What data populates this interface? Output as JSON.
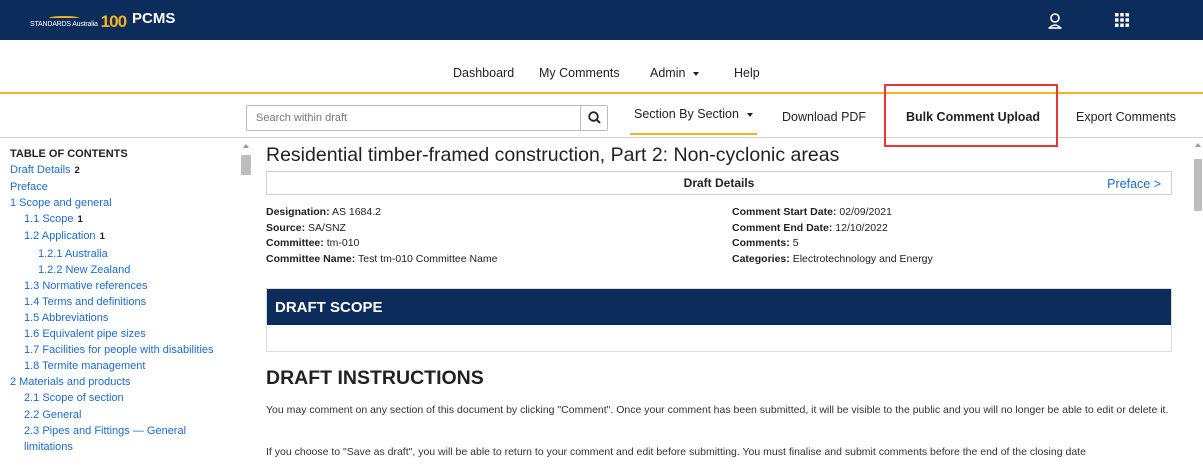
{
  "header": {
    "logo_text_small": "STANDARDS Australia",
    "logo_text_big": "100",
    "app_name": "PCMS"
  },
  "nav": {
    "dashboard": "Dashboard",
    "my_comments": "My Comments",
    "admin": "Admin",
    "help": "Help"
  },
  "toolbar": {
    "search_placeholder": "Search within draft",
    "section_by_section": "Section By Section",
    "download_pdf": "Download PDF",
    "bulk_comment_upload": "Bulk Comment Upload",
    "export_comments": "Export Comments"
  },
  "toc": {
    "title": "TABLE OF CONTENTS",
    "items": [
      {
        "label": "Draft Details",
        "count": "2",
        "level": 1
      },
      {
        "label": "Preface",
        "count": "",
        "level": 1
      },
      {
        "label": "1 Scope and general",
        "count": "",
        "level": 1
      },
      {
        "label": "1.1 Scope",
        "count": "1",
        "level": 2
      },
      {
        "label": "1.2 Application",
        "count": "1",
        "level": 2
      },
      {
        "label": "1.2.1 Australia",
        "count": "",
        "level": 3
      },
      {
        "label": "1.2.2 New Zealand",
        "count": "",
        "level": 3
      },
      {
        "label": "1.3 Normative references",
        "count": "",
        "level": 2
      },
      {
        "label": "1.4 Terms and definitions",
        "count": "",
        "level": 2
      },
      {
        "label": "1.5 Abbreviations",
        "count": "",
        "level": 2
      },
      {
        "label": "1.6 Equivalent pipe sizes",
        "count": "",
        "level": 2
      },
      {
        "label": "1.7 Facilities for people with disabilities",
        "count": "",
        "level": 2
      },
      {
        "label": "1.8 Termite management",
        "count": "",
        "level": 2
      },
      {
        "label": "2 Materials and products",
        "count": "",
        "level": 1
      },
      {
        "label": "2.1 Scope of section",
        "count": "",
        "level": 2
      },
      {
        "label": "2.2 General",
        "count": "",
        "level": 2
      },
      {
        "label": "2.3 Pipes and Fittings — General limitations",
        "count": "",
        "level": 2
      }
    ]
  },
  "document": {
    "title": "Residential timber-framed construction, Part 2: Non-cyclonic areas",
    "details_label": "Draft Details",
    "preface_link": "Preface >",
    "meta_left": [
      {
        "label": "Designation:",
        "value": "AS 1684.2"
      },
      {
        "label": "Source:",
        "value": "SA/SNZ"
      },
      {
        "label": "Committee:",
        "value": "tm-010"
      },
      {
        "label": "Committee Name:",
        "value": "Test tm-010 Committee Name"
      }
    ],
    "meta_right": [
      {
        "label": "Comment Start Date:",
        "value": "02/09/2021"
      },
      {
        "label": "Comment End Date:",
        "value": "12/10/2022"
      },
      {
        "label": "Comments:",
        "value": "5"
      },
      {
        "label": "Categories:",
        "value": "Electrotechnology and Energy"
      }
    ],
    "scope_heading": "DRAFT SCOPE",
    "instructions_heading": "DRAFT INSTRUCTIONS",
    "instructions_p1": "You may comment on any section of this document by clicking \"Comment\". Once your comment has been submitted, it will be visible to the public and you will no longer be able to edit or delete it.",
    "instructions_p2": "If you choose to \"Save as draft\", you will be able to return to your comment and edit before submitting. You must finalise and submit comments before the end of the closing date"
  },
  "colors": {
    "navy": "#0c2c5c",
    "accent_gold": "#f2b221",
    "link_blue": "#1a6cc9",
    "highlight_red": "#e53935"
  }
}
